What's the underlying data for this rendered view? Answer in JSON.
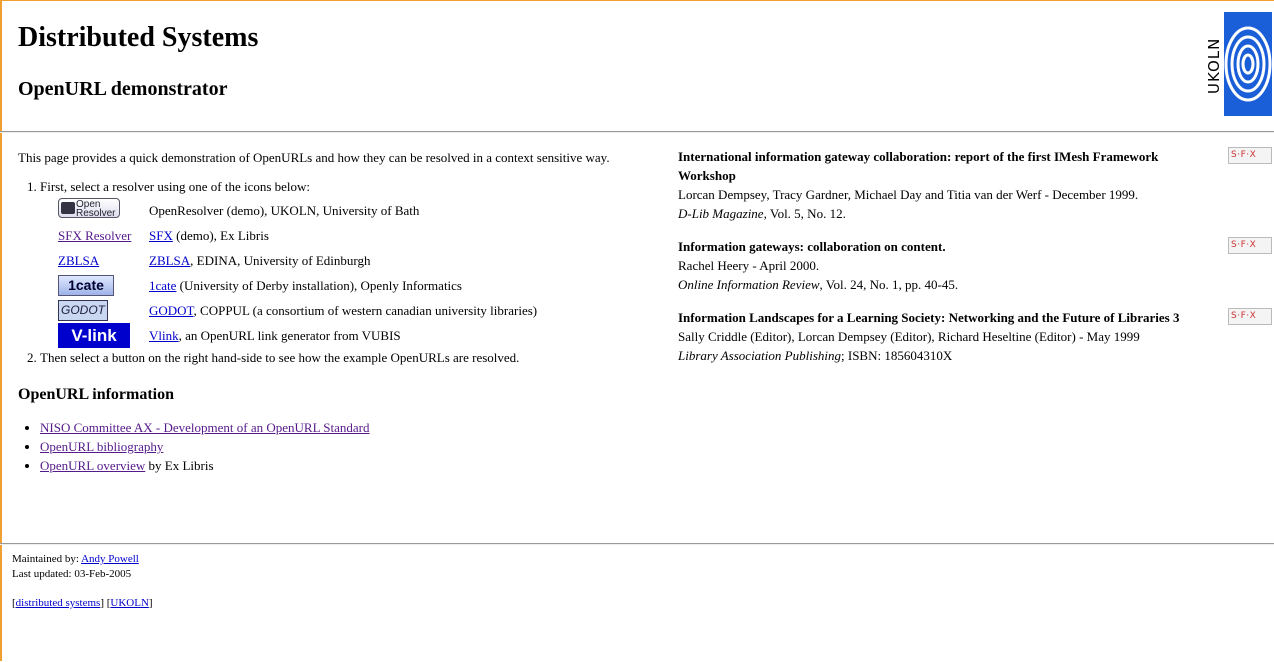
{
  "header": {
    "site_title": "Distributed Systems",
    "page_title": "OpenURL demonstrator",
    "logo_text": "UKOLN"
  },
  "intro": "This page provides a quick demonstration of OpenURLs and how they can be resolved in a context sensitive way.",
  "steps": {
    "step1": "First, select a resolver using one of the icons below:",
    "step2": "Then select a button on the right hand-side to see how the example OpenURLs are resolved."
  },
  "resolvers": [
    {
      "icon_label": "Open Resolver",
      "link": "",
      "desc": "OpenResolver (demo), UKOLN, University of Bath"
    },
    {
      "icon_label": "SFX Resolver",
      "link": "SFX",
      "desc": " (demo), Ex Libris"
    },
    {
      "icon_label": "ZBLSA",
      "link": "ZBLSA",
      "desc": ", EDINA, University of Edinburgh"
    },
    {
      "icon_label": "1cate",
      "link": "1cate",
      "desc": " (University of Derby installation), Openly Informatics"
    },
    {
      "icon_label": "GODOT",
      "link": "GODOT",
      "desc": ", COPPUL (a consortium of western canadian university libraries)"
    },
    {
      "icon_label": "V-link",
      "link": "Vlink",
      "desc": ", an OpenURL link generator from VUBIS"
    }
  ],
  "info_section": {
    "heading": "OpenURL information",
    "links": [
      {
        "text": "NISO Committee AX - Development of an OpenURL Standard",
        "suffix": ""
      },
      {
        "text": "OpenURL bibliography",
        "suffix": ""
      },
      {
        "text": "OpenURL overview",
        "suffix": " by Ex Libris"
      }
    ]
  },
  "references": [
    {
      "title": "International information gateway collaboration: report of the first IMesh Framework Workshop",
      "authors": "Lorcan Dempsey, Tracy Gardner, Michael Day and Titia van der Werf - December 1999.",
      "journal": "D-Lib Magazine",
      "details": ", Vol. 5, No. 12.",
      "button": "S·F·X"
    },
    {
      "title": "Information gateways: collaboration on content.",
      "authors": "Rachel Heery - April 2000.",
      "journal": "Online Information Review",
      "details": ", Vol. 24, No. 1, pp. 40-45.",
      "button": "S·F·X"
    },
    {
      "title": "Information Landscapes for a Learning Society: Networking and the Future of Libraries 3",
      "authors": "Sally Criddle (Editor), Lorcan Dempsey (Editor), Richard Heseltine (Editor) - May 1999",
      "journal": "Library Association Publishing",
      "details": "; ISBN: 185604310X",
      "button": "S·F·X"
    }
  ],
  "footer": {
    "maintained_label": "Maintained by:",
    "maintainer": "Andy Powell",
    "updated": "Last updated: 03-Feb-2005",
    "nav_distributed": "distributed systems",
    "nav_ukoln": "UKOLN"
  },
  "colors": {
    "link": "#0000cc",
    "visited": "#551a8b",
    "frame": "#f0a030",
    "vlink_bg": "#0000cc"
  }
}
